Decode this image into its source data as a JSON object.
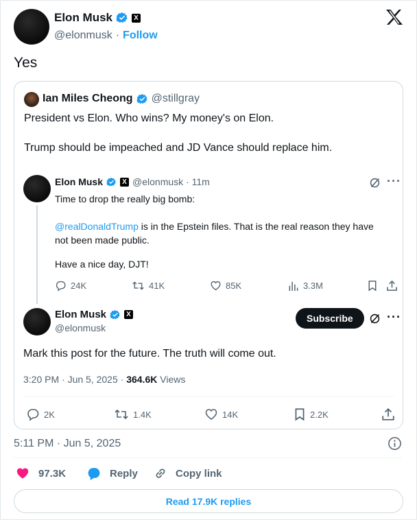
{
  "header": {
    "name": "Elon Musk",
    "handle": "@elonmusk",
    "separator": "·",
    "follow_label": "Follow",
    "x_logo": "𝕏"
  },
  "tweet": {
    "text": "Yes",
    "timestamp": "5:11 PM · Jun 5, 2025"
  },
  "quoted": {
    "name": "Ian Miles Cheong",
    "handle": "@stillgray",
    "text1": "President vs Elon. Who wins? My money's on Elon.",
    "text2": "Trump should be impeached and JD Vance should replace him.",
    "inner": {
      "name": "Elon Musk",
      "handle": "@elonmusk · 11m",
      "line1": "Time to drop the really big bomb:",
      "mention": "@realDonaldTrump",
      "line2a": " is in the Epstein files. That is the real reason they have",
      "line2b": "not been made public.",
      "line3": "Have a nice day, DJT!",
      "replies": "24K",
      "reposts": "41K",
      "likes": "85K",
      "views": "3.3M"
    },
    "second": {
      "name": "Elon Musk",
      "handle": "@elonmusk",
      "subscribe_label": "Subscribe",
      "text": "Mark this post for the future. The truth will come out.",
      "time": "3:20 PM · Jun 5, 2025 · ",
      "views_count": "364.6K",
      "views_label": " Views",
      "replies": "2K",
      "reposts": "1.4K",
      "likes": "14K",
      "bookmarks": "2.2K"
    }
  },
  "footer": {
    "likes": "97.3K",
    "reply_label": "Reply",
    "copy_label": "Copy link",
    "read_replies": "Read 17.9K replies"
  },
  "colors": {
    "accent": "#1d9bf0",
    "like": "#f91880",
    "text": "#0f1419",
    "muted": "#536471"
  }
}
